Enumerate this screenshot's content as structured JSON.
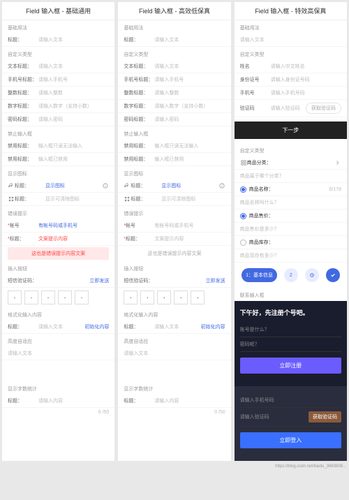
{
  "cols": [
    {
      "title": "Field 输入框 - 基础通用"
    },
    {
      "title": "Field 输入框 - 高效低保真"
    },
    {
      "title": "Field 输入框 - 特效高保真"
    }
  ],
  "sec": {
    "basic": "基础用法",
    "custom": "自定义类型",
    "disabled": "禁止输入框",
    "icon": "显示图标",
    "error": "错误提示",
    "button": "插入按钮",
    "format": "格式化输入内容",
    "auto": "高度自适应",
    "count": "显示字数统计",
    "contact": "联系输入框"
  },
  "basic": {
    "lbl": "标题：",
    "ph": "请输入文本"
  },
  "custom": {
    "text": {
      "lbl": "文本标题：",
      "ph": "请输入文本"
    },
    "phone": {
      "lbl": "手机号标题：",
      "ph": "请输入手机号"
    },
    "int": {
      "lbl": "整数标题：",
      "ph": "请输入整数"
    },
    "num": {
      "lbl": "数字标题：",
      "ph": "请输入数字（支持小数）"
    },
    "pwd": {
      "lbl": "密码标题：",
      "ph": "请输入密码"
    }
  },
  "disabled": {
    "ro": {
      "lbl": "禁用标题：",
      "ph": "输入框只读无法输入"
    },
    "dis": {
      "lbl": "禁用标题：",
      "ph": "输入框已禁用"
    }
  },
  "icon": {
    "left": {
      "lbl": "标题：",
      "ph": "显示图标"
    },
    "clear": {
      "lbl": "标题：",
      "ph": "显示可清除图标"
    }
  },
  "error": {
    "phone": {
      "lbl": "帐号",
      "ph": "有帐号码或手机号",
      "ph2": "有帐号码或手机号"
    },
    "tip": {
      "lbl": "标题：",
      "ph": "文案提示内容",
      "ph2": "文案提示内容"
    },
    "msg": "这也是错误提示内容文案"
  },
  "button": {
    "lbl": "短信验证码：",
    "btn": "立即发送",
    "dots": [
      "·",
      "·",
      "·",
      "·",
      "·"
    ]
  },
  "format": {
    "lbl": "标题：",
    "ph": "请输入文本",
    "btn": "初始化内容"
  },
  "auto": {
    "ph": "请输入文本"
  },
  "count": {
    "lbl": "标题：",
    "ph": "请输入内容",
    "val": "0 /50"
  },
  "col3": {
    "ph": "请输入文本",
    "name": {
      "lbl": "姓名",
      "ph": "请输入中文姓名"
    },
    "id": {
      "lbl": "身份证号",
      "ph": "请输入身份证号码"
    },
    "phone": {
      "lbl": "手机号",
      "ph": "请输入手机号码"
    },
    "code": {
      "lbl": "验证码",
      "ph": "请输入验证码",
      "btn": "获取验证码"
    },
    "next": "下一步",
    "cat": {
      "lbl": "商品分类：",
      "ph": "商品属于哪个分类？"
    },
    "pname": {
      "lbl": "商品名称：",
      "ph": "商品名称叫什么？",
      "cnt": "0/178"
    },
    "price": {
      "lbl": "商品售价：",
      "ph": "商品售价是多少？"
    },
    "stock": {
      "lbl": "商品库存：",
      "ph": "商品现存有多少？"
    },
    "steps": {
      "s1": "1：基本信息",
      "s2": "2"
    },
    "dark": {
      "title": "下午好，先注册个号吧。",
      "acc": "账号是什么？",
      "pwd": "密码呢？",
      "reg": "立即注册",
      "phone": "请输入手机号码",
      "code": "请输入验证码",
      "get": "获取验证码",
      "login": "立即登入"
    }
  },
  "footer": "https://blog.csdn.net/baidu_3683608..."
}
